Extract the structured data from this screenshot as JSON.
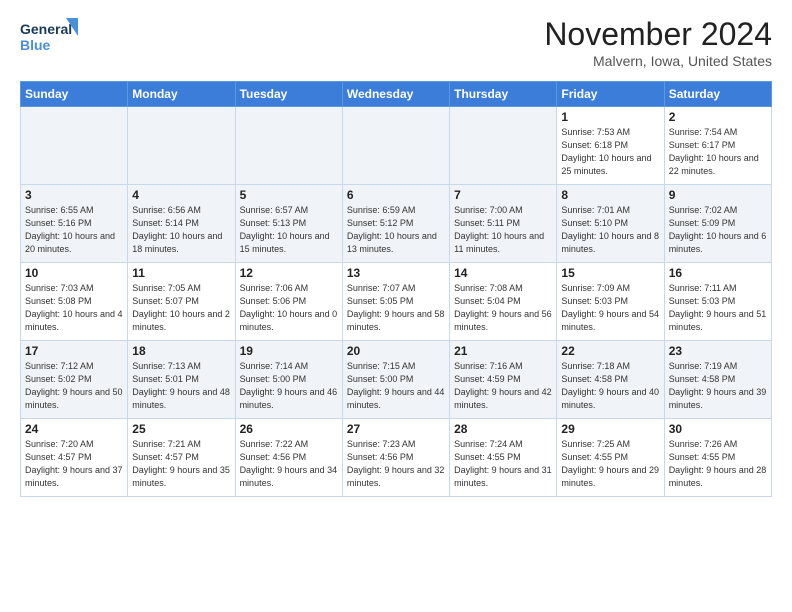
{
  "header": {
    "logo_line1": "General",
    "logo_line2": "Blue",
    "month": "November 2024",
    "location": "Malvern, Iowa, United States"
  },
  "days_of_week": [
    "Sunday",
    "Monday",
    "Tuesday",
    "Wednesday",
    "Thursday",
    "Friday",
    "Saturday"
  ],
  "weeks": [
    [
      {
        "day": "",
        "info": ""
      },
      {
        "day": "",
        "info": ""
      },
      {
        "day": "",
        "info": ""
      },
      {
        "day": "",
        "info": ""
      },
      {
        "day": "",
        "info": ""
      },
      {
        "day": "1",
        "info": "Sunrise: 7:53 AM\nSunset: 6:18 PM\nDaylight: 10 hours\nand 25 minutes."
      },
      {
        "day": "2",
        "info": "Sunrise: 7:54 AM\nSunset: 6:17 PM\nDaylight: 10 hours\nand 22 minutes."
      }
    ],
    [
      {
        "day": "3",
        "info": "Sunrise: 6:55 AM\nSunset: 5:16 PM\nDaylight: 10 hours\nand 20 minutes."
      },
      {
        "day": "4",
        "info": "Sunrise: 6:56 AM\nSunset: 5:14 PM\nDaylight: 10 hours\nand 18 minutes."
      },
      {
        "day": "5",
        "info": "Sunrise: 6:57 AM\nSunset: 5:13 PM\nDaylight: 10 hours\nand 15 minutes."
      },
      {
        "day": "6",
        "info": "Sunrise: 6:59 AM\nSunset: 5:12 PM\nDaylight: 10 hours\nand 13 minutes."
      },
      {
        "day": "7",
        "info": "Sunrise: 7:00 AM\nSunset: 5:11 PM\nDaylight: 10 hours\nand 11 minutes."
      },
      {
        "day": "8",
        "info": "Sunrise: 7:01 AM\nSunset: 5:10 PM\nDaylight: 10 hours\nand 8 minutes."
      },
      {
        "day": "9",
        "info": "Sunrise: 7:02 AM\nSunset: 5:09 PM\nDaylight: 10 hours\nand 6 minutes."
      }
    ],
    [
      {
        "day": "10",
        "info": "Sunrise: 7:03 AM\nSunset: 5:08 PM\nDaylight: 10 hours\nand 4 minutes."
      },
      {
        "day": "11",
        "info": "Sunrise: 7:05 AM\nSunset: 5:07 PM\nDaylight: 10 hours\nand 2 minutes."
      },
      {
        "day": "12",
        "info": "Sunrise: 7:06 AM\nSunset: 5:06 PM\nDaylight: 10 hours\nand 0 minutes."
      },
      {
        "day": "13",
        "info": "Sunrise: 7:07 AM\nSunset: 5:05 PM\nDaylight: 9 hours\nand 58 minutes."
      },
      {
        "day": "14",
        "info": "Sunrise: 7:08 AM\nSunset: 5:04 PM\nDaylight: 9 hours\nand 56 minutes."
      },
      {
        "day": "15",
        "info": "Sunrise: 7:09 AM\nSunset: 5:03 PM\nDaylight: 9 hours\nand 54 minutes."
      },
      {
        "day": "16",
        "info": "Sunrise: 7:11 AM\nSunset: 5:03 PM\nDaylight: 9 hours\nand 51 minutes."
      }
    ],
    [
      {
        "day": "17",
        "info": "Sunrise: 7:12 AM\nSunset: 5:02 PM\nDaylight: 9 hours\nand 50 minutes."
      },
      {
        "day": "18",
        "info": "Sunrise: 7:13 AM\nSunset: 5:01 PM\nDaylight: 9 hours\nand 48 minutes."
      },
      {
        "day": "19",
        "info": "Sunrise: 7:14 AM\nSunset: 5:00 PM\nDaylight: 9 hours\nand 46 minutes."
      },
      {
        "day": "20",
        "info": "Sunrise: 7:15 AM\nSunset: 5:00 PM\nDaylight: 9 hours\nand 44 minutes."
      },
      {
        "day": "21",
        "info": "Sunrise: 7:16 AM\nSunset: 4:59 PM\nDaylight: 9 hours\nand 42 minutes."
      },
      {
        "day": "22",
        "info": "Sunrise: 7:18 AM\nSunset: 4:58 PM\nDaylight: 9 hours\nand 40 minutes."
      },
      {
        "day": "23",
        "info": "Sunrise: 7:19 AM\nSunset: 4:58 PM\nDaylight: 9 hours\nand 39 minutes."
      }
    ],
    [
      {
        "day": "24",
        "info": "Sunrise: 7:20 AM\nSunset: 4:57 PM\nDaylight: 9 hours\nand 37 minutes."
      },
      {
        "day": "25",
        "info": "Sunrise: 7:21 AM\nSunset: 4:57 PM\nDaylight: 9 hours\nand 35 minutes."
      },
      {
        "day": "26",
        "info": "Sunrise: 7:22 AM\nSunset: 4:56 PM\nDaylight: 9 hours\nand 34 minutes."
      },
      {
        "day": "27",
        "info": "Sunrise: 7:23 AM\nSunset: 4:56 PM\nDaylight: 9 hours\nand 32 minutes."
      },
      {
        "day": "28",
        "info": "Sunrise: 7:24 AM\nSunset: 4:55 PM\nDaylight: 9 hours\nand 31 minutes."
      },
      {
        "day": "29",
        "info": "Sunrise: 7:25 AM\nSunset: 4:55 PM\nDaylight: 9 hours\nand 29 minutes."
      },
      {
        "day": "30",
        "info": "Sunrise: 7:26 AM\nSunset: 4:55 PM\nDaylight: 9 hours\nand 28 minutes."
      }
    ]
  ]
}
